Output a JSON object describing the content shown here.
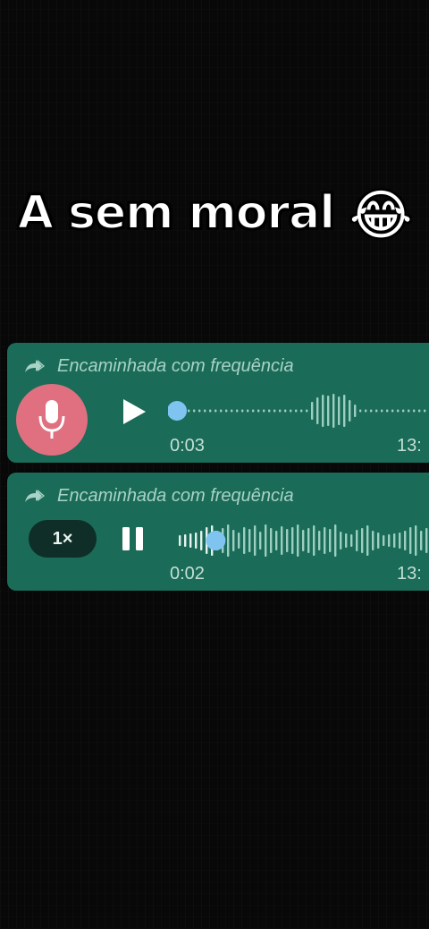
{
  "caption": {
    "text": "A sem moral",
    "emoji": "😂"
  },
  "messages": [
    {
      "forwarded_label": "Encaminhada com frequência",
      "duration": "0:03",
      "timestamp": "13:",
      "state": "paused",
      "progress": 0.0
    },
    {
      "forwarded_label": "Encaminhada com frequência",
      "duration": "0:02",
      "timestamp": "13:",
      "speed": "1×",
      "state": "playing",
      "progress": 0.13
    }
  ],
  "colors": {
    "bubble": "#1a6b58",
    "accent_dot": "#7fc4f0",
    "mic_avatar": "#e0707f"
  }
}
